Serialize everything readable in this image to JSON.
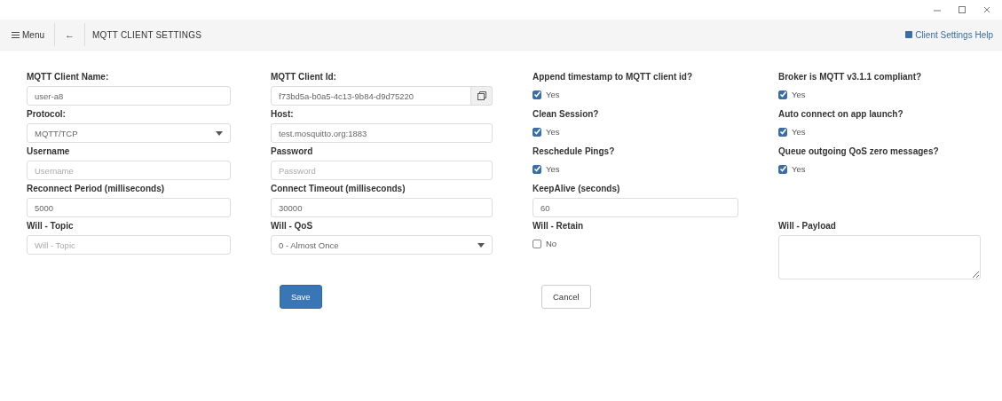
{
  "toolbar": {
    "menu_label": "Menu",
    "back_icon": "←",
    "title": "MQTT CLIENT SETTINGS",
    "help_link": "Client Settings Help"
  },
  "rows": [
    [
      {
        "kind": "text",
        "label": "MQTT Client Name:",
        "value": "user-a8"
      },
      {
        "kind": "copy",
        "label": "MQTT Client Id:",
        "value": "f73bd5a-b0a5-4c13-9b84-d9d75220"
      },
      {
        "kind": "checkbox",
        "label": "Append timestamp to MQTT client id?",
        "option": "Yes",
        "checked": true
      },
      {
        "kind": "checkbox",
        "label": "Broker is MQTT v3.1.1 compliant?",
        "option": "Yes",
        "checked": true
      }
    ],
    [
      {
        "kind": "select",
        "label": "Protocol:",
        "value": "MQTT/TCP"
      },
      {
        "kind": "text",
        "label": "Host:",
        "value": "test.mosquitto.org:1883"
      },
      {
        "kind": "checkbox",
        "label": "Clean Session?",
        "option": "Yes",
        "checked": true
      },
      {
        "kind": "checkbox",
        "label": "Auto connect on app launch?",
        "option": "Yes",
        "checked": true
      }
    ],
    [
      {
        "kind": "text",
        "label": "Username",
        "placeholder": "Username"
      },
      {
        "kind": "text",
        "label": "Password",
        "placeholder": "Password"
      },
      {
        "kind": "checkbox",
        "label": "Reschedule Pings?",
        "option": "Yes",
        "checked": true
      },
      {
        "kind": "checkbox",
        "label": "Queue outgoing QoS zero messages?",
        "option": "Yes",
        "checked": true
      }
    ],
    [
      {
        "kind": "text",
        "label": "Reconnect Period (milliseconds)",
        "value": "5000"
      },
      {
        "kind": "text",
        "label": "Connect Timeout (milliseconds)",
        "value": "30000"
      },
      {
        "kind": "text",
        "label": "KeepAlive (seconds)",
        "value": "60"
      }
    ],
    [
      {
        "kind": "text",
        "label": "Will - Topic",
        "placeholder": "Will - Topic"
      },
      {
        "kind": "select",
        "label": "Will - QoS",
        "value": "0 - Almost Once"
      },
      {
        "kind": "checkbox",
        "label": "Will - Retain",
        "option": "No",
        "checked": false
      },
      {
        "kind": "textarea",
        "label": "Will - Payload"
      }
    ]
  ],
  "actions": [
    {
      "label": "Save",
      "kind": "primary"
    },
    {
      "label": "Cancel",
      "kind": "default"
    }
  ]
}
